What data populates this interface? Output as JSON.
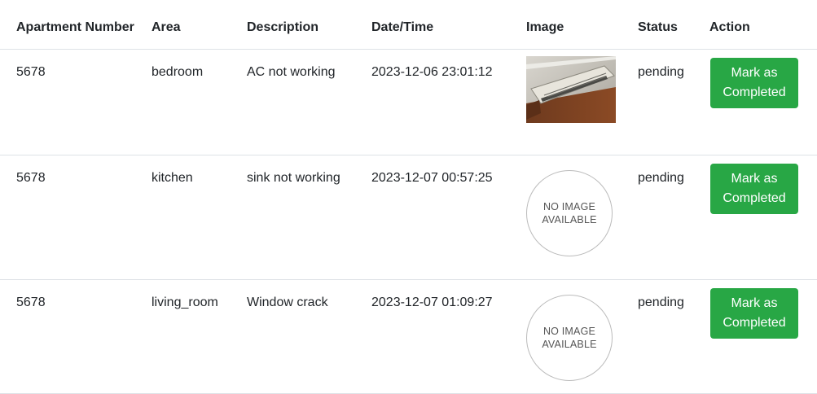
{
  "table": {
    "headers": [
      "Apartment Number",
      "Area",
      "Description",
      "Date/Time",
      "Image",
      "Status",
      "Action"
    ],
    "rows": [
      {
        "apartment": "5678",
        "area": "bedroom",
        "description": "AC not working",
        "datetime": "2023-12-06 23:01:12",
        "image": "photo",
        "status": "pending",
        "action_label": "Mark as Completed"
      },
      {
        "apartment": "5678",
        "area": "kitchen",
        "description": "sink not working",
        "datetime": "2023-12-07 00:57:25",
        "image": "none",
        "no_image_line1": "NO IMAGE",
        "no_image_line2": "AVAILABLE",
        "status": "pending",
        "action_label": "Mark as Completed"
      },
      {
        "apartment": "5678",
        "area": "living_room",
        "description": "Window crack",
        "datetime": "2023-12-07 01:09:27",
        "image": "none",
        "no_image_line1": "NO IMAGE",
        "no_image_line2": "AVAILABLE",
        "status": "pending",
        "action_label": "Mark as Completed"
      }
    ]
  },
  "colors": {
    "action_button": "#28a745",
    "divider": "#dee2e6"
  }
}
